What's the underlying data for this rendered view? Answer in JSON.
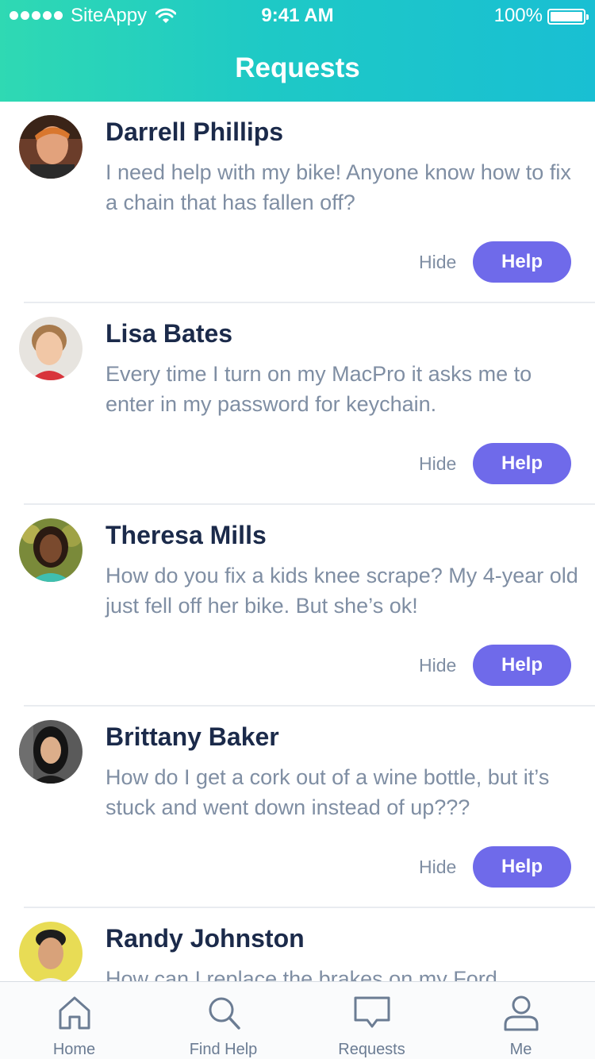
{
  "status_bar": {
    "carrier": "SiteAppy",
    "time": "9:41 AM",
    "battery": "100%"
  },
  "header": {
    "title": "Requests"
  },
  "requests": [
    {
      "name": "Darrell Phillips",
      "message": "I need help with my bike! Anyone know how to fix a chain that has fallen off?",
      "hide_label": "Hide",
      "help_label": "Help"
    },
    {
      "name": "Lisa Bates",
      "message": "Every time I turn on my MacPro it asks me to enter in my password for keychain.",
      "hide_label": "Hide",
      "help_label": "Help"
    },
    {
      "name": "Theresa Mills",
      "message": "How do you fix a kids knee scrape? My 4-year old just fell off her bike. But she’s ok!",
      "hide_label": "Hide",
      "help_label": "Help"
    },
    {
      "name": "Brittany Baker",
      "message": "How do I get a cork out of a wine bottle, but it’s stuck and went down instead of up???",
      "hide_label": "Hide",
      "help_label": "Help"
    },
    {
      "name": "Randy Johnston",
      "message": "How can I replace the brakes on my Ford"
    }
  ],
  "tabbar": {
    "tabs": [
      {
        "label": "Home",
        "icon": "home-icon"
      },
      {
        "label": "Find Help",
        "icon": "search-icon"
      },
      {
        "label": "Requests",
        "icon": "chat-bubble-icon"
      },
      {
        "label": "Me",
        "icon": "person-icon"
      }
    ]
  },
  "colors": {
    "header_gradient_start": "#2fd9b3",
    "header_gradient_end": "#19bfd3",
    "help_button": "#6f6aea",
    "name_text": "#1b2a4a",
    "message_text": "#7f8ea3"
  }
}
